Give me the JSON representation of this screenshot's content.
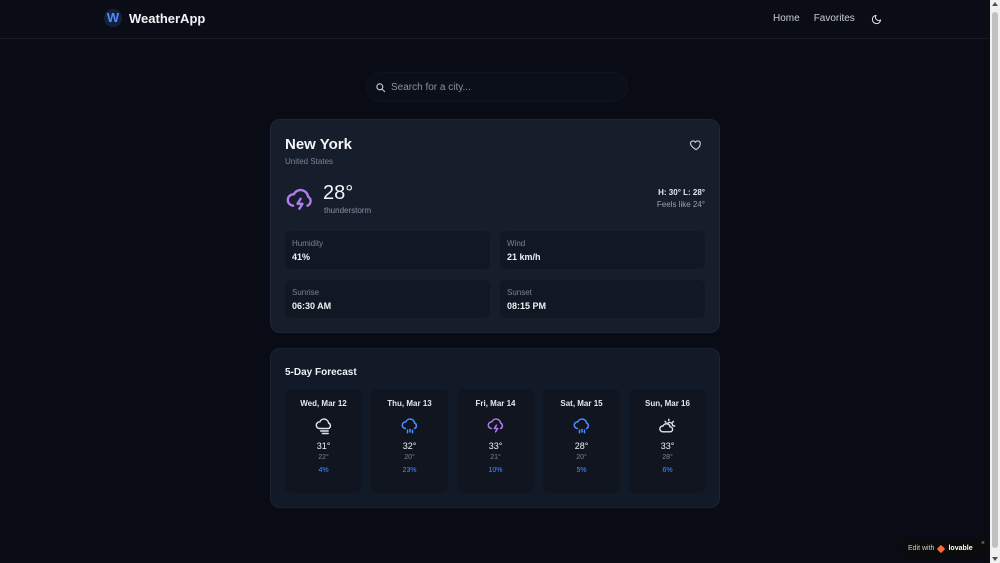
{
  "header": {
    "logo_letter": "W",
    "app_name": "WeatherApp",
    "nav": [
      "Home",
      "Favorites"
    ],
    "theme_icon": "moon-icon"
  },
  "search": {
    "placeholder": "Search for a city..."
  },
  "current": {
    "city": "New York",
    "country": "United States",
    "temp": "28°",
    "condition": "thunderstorm",
    "condition_icon": "thunderstorm-icon",
    "hi_lo": "H: 30° L: 28°",
    "feels_like": "Feels like 24°",
    "stats": [
      {
        "label": "Humidity",
        "value": "41%"
      },
      {
        "label": "Wind",
        "value": "21 km/h"
      },
      {
        "label": "Sunrise",
        "value": "06:30 AM"
      },
      {
        "label": "Sunset",
        "value": "08:15 PM"
      }
    ]
  },
  "forecast": {
    "title": "5-Day Forecast",
    "days": [
      {
        "date": "Wed, Mar 12",
        "icon": "cloud-rain-icon",
        "hi": "31°",
        "lo": "22°",
        "pop": "4%"
      },
      {
        "date": "Thu, Mar 13",
        "icon": "rain-icon",
        "hi": "32°",
        "lo": "20°",
        "pop": "23%"
      },
      {
        "date": "Fri, Mar 14",
        "icon": "thunderstorm-icon",
        "hi": "33°",
        "lo": "21°",
        "pop": "10%"
      },
      {
        "date": "Sat, Mar 15",
        "icon": "rain-icon",
        "hi": "28°",
        "lo": "20°",
        "pop": "5%"
      },
      {
        "date": "Sun, Mar 16",
        "icon": "partly-cloudy-icon",
        "hi": "33°",
        "lo": "28°",
        "pop": "6%"
      }
    ]
  },
  "badge": {
    "prefix": "Edit with",
    "brand": "lovable",
    "close": "×"
  },
  "colors": {
    "background": "#090c14",
    "card": "#161d2b",
    "accent_blue": "#4f8cff",
    "storm_purple": "#b07cf0"
  }
}
